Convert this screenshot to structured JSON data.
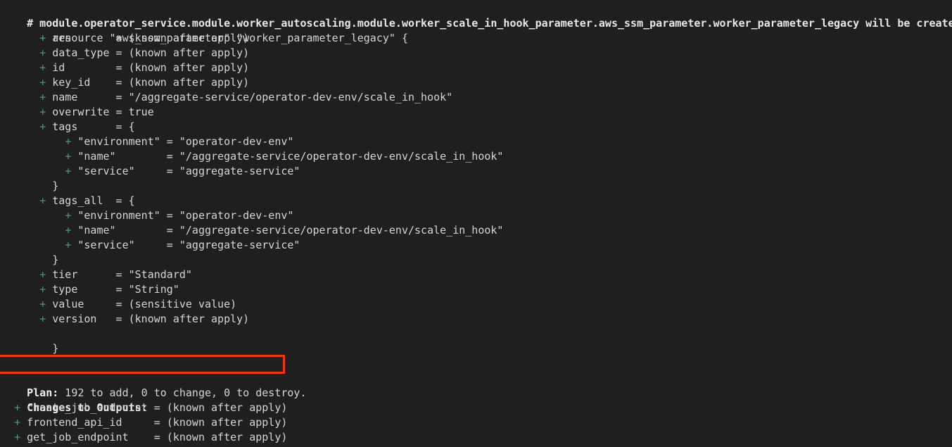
{
  "terminal": {
    "background_color": "#1f1f1f",
    "foreground_color": "#d6d6d6",
    "add_marker_color": "#4c9a6b",
    "highlight_border_color": "#f0380f",
    "resource_header": "# module.operator_service.module.worker_autoscaling.module.worker_scale_in_hook_parameter.aws_ssm_parameter.worker_parameter_legacy will be created",
    "resource_open": "  + resource \"aws_ssm_parameter\" \"worker_parameter_legacy\" {",
    "attributes": [
      "      + arn       = (known after apply)",
      "      + data_type = (known after apply)",
      "      + id        = (known after apply)",
      "      + key_id    = (known after apply)",
      "      + name      = \"/aggregate-service/operator-dev-env/scale_in_hook\"",
      "      + overwrite = true",
      "      + tags      = {",
      "          + \"environment\" = \"operator-dev-env\"",
      "          + \"name\"        = \"/aggregate-service/operator-dev-env/scale_in_hook\"",
      "          + \"service\"     = \"aggregate-service\"",
      "        }",
      "      + tags_all  = {",
      "          + \"environment\" = \"operator-dev-env\"",
      "          + \"name\"        = \"/aggregate-service/operator-dev-env/scale_in_hook\"",
      "          + \"service\"     = \"aggregate-service\"",
      "        }",
      "      + tier      = \"Standard\"",
      "      + type      = \"String\"",
      "      + value     = (sensitive value)",
      "      + version   = (known after apply)"
    ],
    "resource_close": "    }",
    "plan_summary": {
      "label": "Plan:",
      "detail": " 192 to add, 0 to change, 0 to destroy.",
      "add_count": "192",
      "change_count": "0",
      "destroy_count": "0"
    },
    "outputs_header": "Changes to Outputs:",
    "outputs": [
      "  + create_job_endpoint = (known after apply)",
      "  + frontend_api_id     = (known after apply)",
      "  + get_job_endpoint    = (known after apply)"
    ]
  }
}
